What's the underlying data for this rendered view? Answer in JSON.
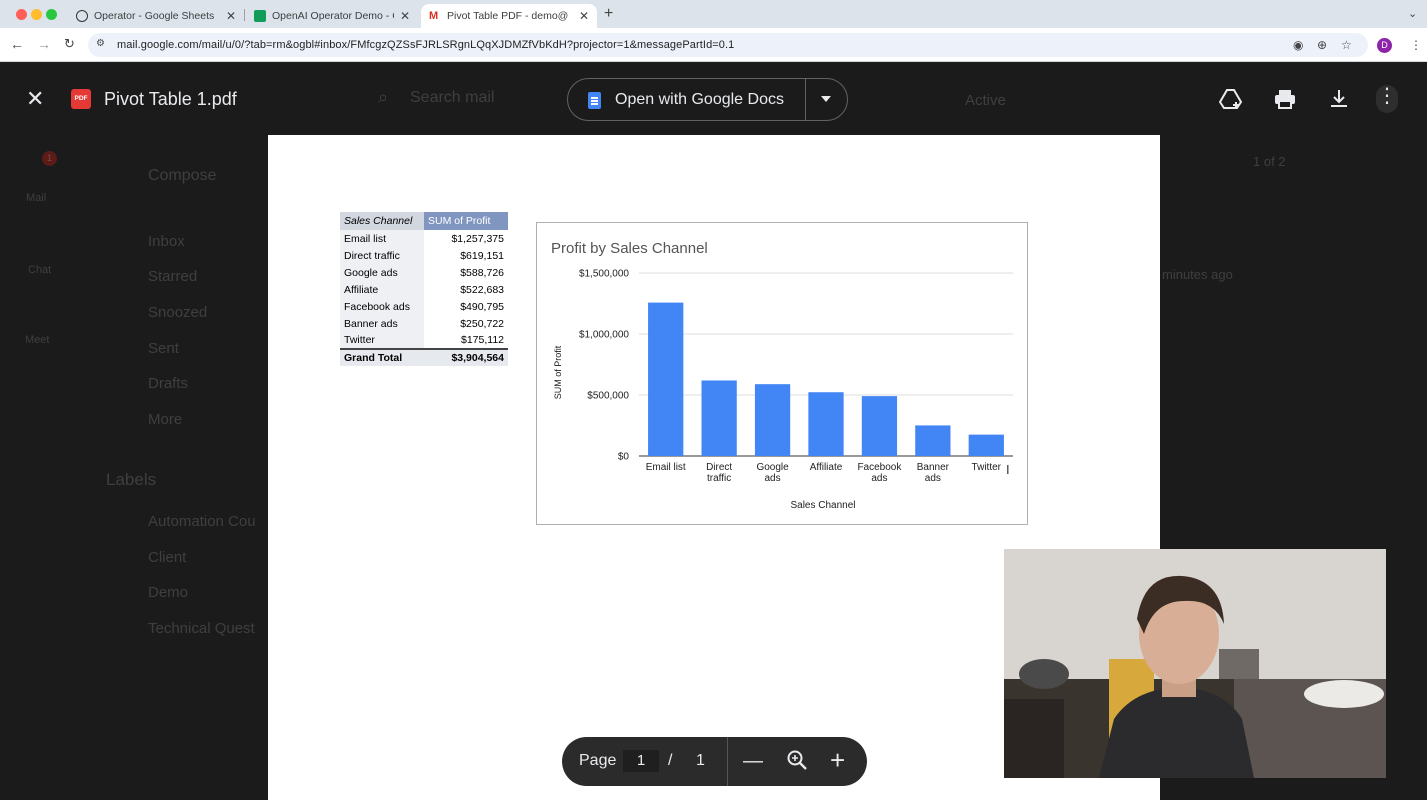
{
  "browser": {
    "tabs": [
      {
        "title": "Operator - Google Sheets as",
        "active": false
      },
      {
        "title": "OpenAI Operator Demo - Go",
        "active": false
      },
      {
        "title": "Pivot Table PDF - demo@ben",
        "active": true
      }
    ],
    "url": "mail.google.com/mail/u/0/?tab=rm&ogbl#inbox/FMfcgzQZSsFJRLSRgnLQqXJDMZfVbKdH?projector=1&messagePartId=0.1",
    "profile_initial": "D"
  },
  "viewer": {
    "file_name": "Pivot Table 1.pdf",
    "pdf_badge": "PDF",
    "open_with_label": "Open with Google Docs"
  },
  "gmail_background": {
    "search_placeholder": "Search mail",
    "status": "Active",
    "compose": "Compose",
    "nav": [
      "Inbox",
      "Starred",
      "Snoozed",
      "Sent",
      "Drafts",
      "More"
    ],
    "rail": [
      "Mail",
      "Chat",
      "Meet"
    ],
    "labels_header": "Labels",
    "labels": [
      "Automation Cou",
      "Client",
      "Demo",
      "Technical Quest"
    ],
    "pagination": "1 of 2",
    "mail_badge": "1",
    "time_text": "minutes ago"
  },
  "pivot_table": {
    "header_col1": "Sales Channel",
    "header_col2": "SUM of Profit",
    "rows": [
      {
        "channel": "Email list",
        "profit": "$1,257,375"
      },
      {
        "channel": "Direct traffic",
        "profit": "$619,151"
      },
      {
        "channel": "Google ads",
        "profit": "$588,726"
      },
      {
        "channel": "Affiliate",
        "profit": "$522,683"
      },
      {
        "channel": "Facebook ads",
        "profit": "$490,795"
      },
      {
        "channel": "Banner ads",
        "profit": "$250,722"
      },
      {
        "channel": "Twitter",
        "profit": "$175,112"
      }
    ],
    "total_label": "Grand Total",
    "total_value": "$3,904,564"
  },
  "chart_data": {
    "type": "bar",
    "title": "Profit by Sales Channel",
    "xlabel": "Sales Channel",
    "ylabel": "SUM of Profit",
    "categories": [
      [
        "Email list"
      ],
      [
        "Direct",
        "traffic"
      ],
      [
        "Google",
        "ads"
      ],
      [
        "Affiliate"
      ],
      [
        "Facebook",
        "ads"
      ],
      [
        "Banner",
        "ads"
      ],
      [
        "Twitter"
      ]
    ],
    "values": [
      1257375,
      619151,
      588726,
      522683,
      490795,
      250722,
      175112
    ],
    "ylim": [
      0,
      1500000
    ],
    "yticks": [
      "$0",
      "$500,000",
      "$1,000,000",
      "$1,500,000"
    ],
    "grid": true,
    "bar_color": "#4285f4"
  },
  "page_controls": {
    "page_label": "Page",
    "current_page": "1",
    "separator": "/",
    "total_pages": "1"
  }
}
